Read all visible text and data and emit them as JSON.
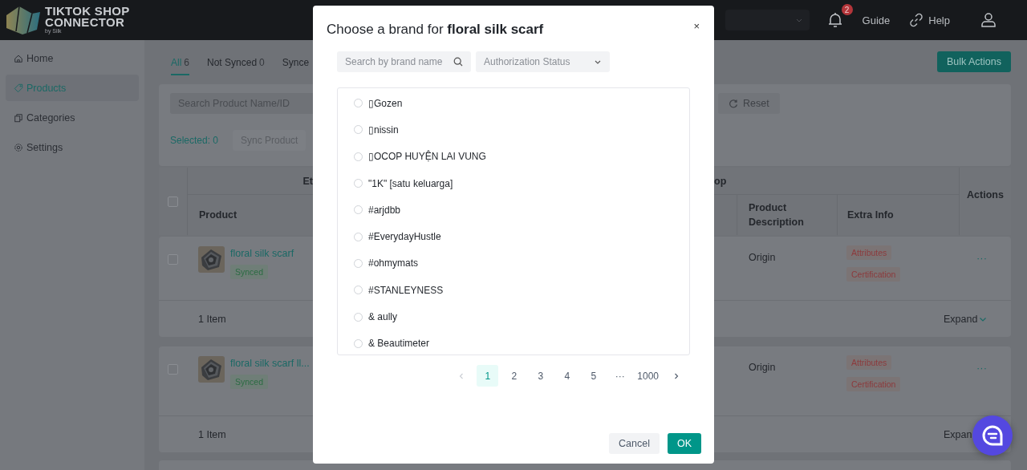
{
  "header": {
    "logo": {
      "line_1": "TIKTOK SHOP",
      "line_2": "CONNECTOR",
      "tagline": "by Silk"
    },
    "notifications": {
      "count": "2"
    },
    "links": [
      {
        "label": "Guide",
        "kind": "guide"
      },
      {
        "label": "Help",
        "kind": "help"
      }
    ]
  },
  "sidebar": {
    "items": [
      {
        "label": "Home",
        "kind": "home",
        "selected": false
      },
      {
        "label": "Products",
        "kind": "products",
        "selected": true
      },
      {
        "label": "Categories",
        "kind": "categories",
        "selected": false
      },
      {
        "label": "Settings",
        "kind": "settings",
        "selected": false
      }
    ]
  },
  "tabs": [
    {
      "label": "All",
      "count": "6",
      "selected": true
    },
    {
      "label": "Not Synced",
      "count": "0",
      "selected": false
    },
    {
      "label": "Synce",
      "selected": false
    }
  ],
  "bulk_actions": "Bulk Actions",
  "filters": {
    "search": {
      "placeholder": "Search Product Name/ID"
    },
    "reset": "Reset",
    "selected_label": "Selected: 0",
    "sync_button": "Sync Product"
  },
  "table": {
    "select_all": {
      "checked": false
    },
    "group_headers": [
      "Et",
      "op"
    ],
    "columns": [
      "Product",
      "Product Description",
      "Extra Info",
      "Actions"
    ],
    "rows": [
      {
        "checked": false,
        "name": "floral silk scarf",
        "status": "Synced",
        "description": "Origin",
        "extra_info": [
          "Attributes",
          "Certification"
        ],
        "actions": "···",
        "footer": "1 Item",
        "expand": "Expand",
        "expand_icon": true
      },
      {
        "checked": false,
        "name": "floral silk scarf ll...",
        "status": "Synced",
        "description": "Origin",
        "extra_info": [
          "Attributes",
          "Certification"
        ],
        "actions": "···",
        "footer": "1 Item",
        "expand": "Expan",
        "expand_icon": false
      }
    ]
  },
  "modal": {
    "close": "×",
    "title": "Choose a brand for  **floral silk scarf**",
    "search": {
      "placeholder": "Search by brand name"
    },
    "filter": {
      "placeholder": "Authorization Status"
    },
    "brands": [
      {
        "name": "▯Gozen",
        "selected": false
      },
      {
        "name": "▯nissin",
        "selected": false
      },
      {
        "name": "▯OCOP HUYỆN LAI VUNG",
        "selected": false
      },
      {
        "name": "\"1K\" [satu keluarga]",
        "selected": false
      },
      {
        "name": "#arjdbb",
        "selected": false
      },
      {
        "name": "#EverydayHustle",
        "selected": false
      },
      {
        "name": "#ohmymats",
        "selected": false
      },
      {
        "name": "#STANLEYNESS",
        "selected": false
      },
      {
        "name": "& aully",
        "selected": false
      },
      {
        "name": "& Beautimeter",
        "selected": false
      }
    ],
    "pagination": {
      "pages": [
        {
          "label": "1",
          "selected": true
        },
        {
          "label": "2",
          "selected": false
        },
        {
          "label": "3",
          "selected": false
        },
        {
          "label": "4",
          "selected": false
        },
        {
          "label": "5",
          "selected": false
        },
        {
          "label": "···",
          "selected": false
        },
        {
          "label": "1000",
          "selected": false
        }
      ]
    },
    "buttons": [
      {
        "label": "Cancel",
        "kind": "default"
      },
      {
        "label": "OK",
        "kind": "primary"
      }
    ]
  }
}
